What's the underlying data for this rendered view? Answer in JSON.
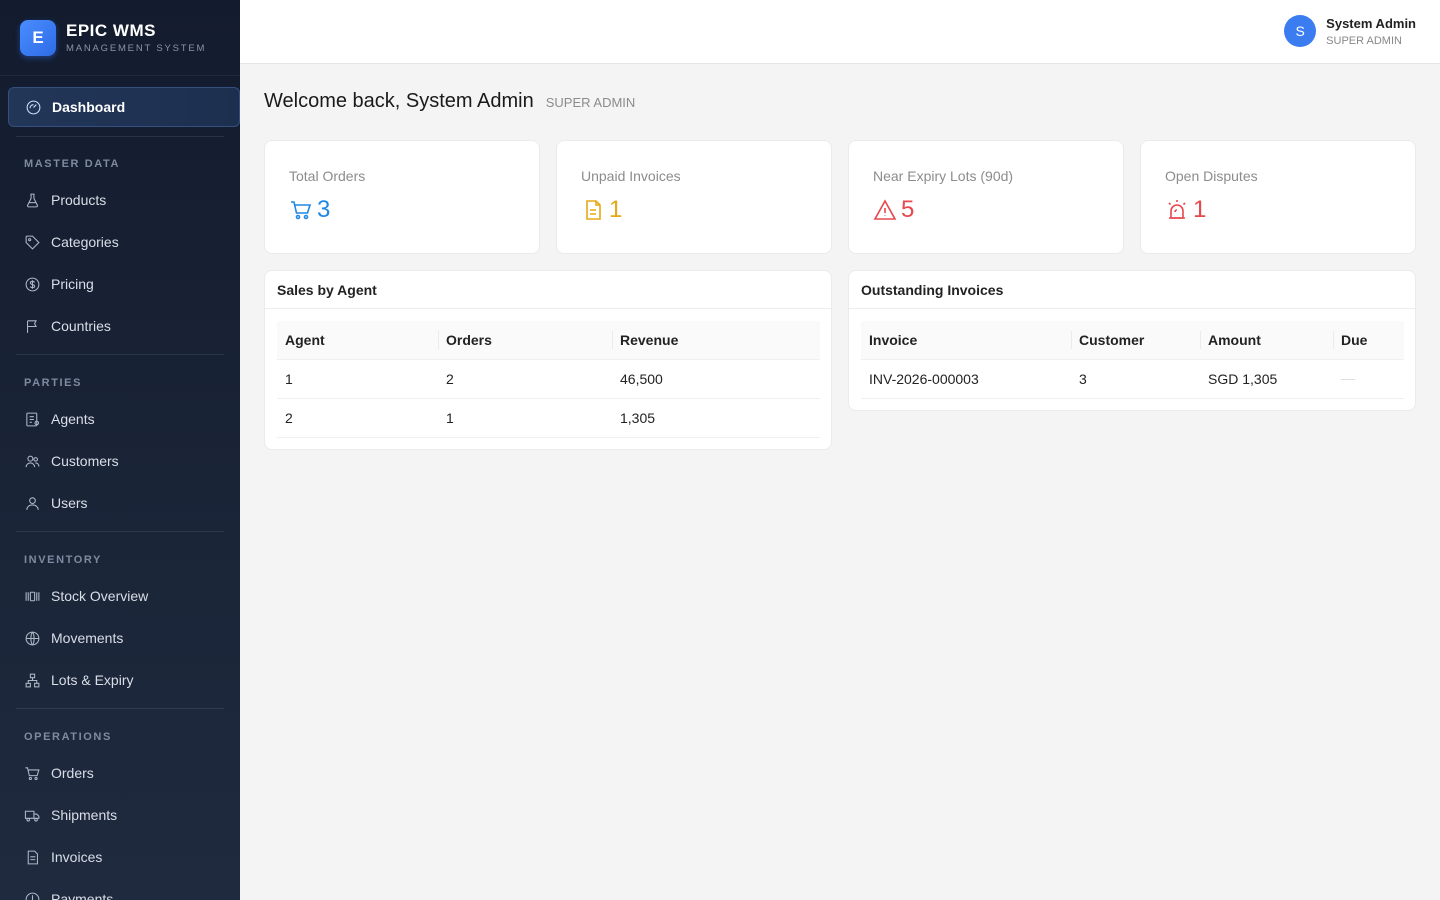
{
  "brand": {
    "logo_letter": "E",
    "title": "EPIC WMS",
    "subtitle": "MANAGEMENT SYSTEM"
  },
  "sidebar": {
    "active": "Dashboard",
    "sections": {
      "master_data": "MASTER DATA",
      "parties": "PARTIES",
      "inventory": "INVENTORY",
      "operations": "OPERATIONS"
    },
    "items": {
      "dashboard": "Dashboard",
      "products": "Products",
      "categories": "Categories",
      "pricing": "Pricing",
      "countries": "Countries",
      "agents": "Agents",
      "customers": "Customers",
      "users": "Users",
      "stock_overview": "Stock Overview",
      "movements": "Movements",
      "lots_expiry": "Lots & Expiry",
      "orders": "Orders",
      "shipments": "Shipments",
      "invoices": "Invoices",
      "payments": "Payments"
    }
  },
  "header": {
    "user_initial": "S",
    "user_name": "System Admin",
    "user_role": "SUPER ADMIN"
  },
  "welcome": {
    "title": "Welcome back, System Admin",
    "role": "SUPER ADMIN"
  },
  "stats": [
    {
      "label": "Total Orders",
      "value": "3",
      "icon": "cart-icon",
      "color": "#1e88e5"
    },
    {
      "label": "Unpaid Invoices",
      "value": "1",
      "icon": "document-icon",
      "color": "#e6a817"
    },
    {
      "label": "Near Expiry Lots (90d)",
      "value": "5",
      "icon": "warning-icon",
      "color": "#e5484d"
    },
    {
      "label": "Open Disputes",
      "value": "1",
      "icon": "alarm-icon",
      "color": "#e5484d"
    }
  ],
  "sales_by_agent": {
    "title": "Sales by Agent",
    "columns": [
      "Agent",
      "Orders",
      "Revenue"
    ],
    "rows": [
      [
        "1",
        "2",
        "46,500"
      ],
      [
        "2",
        "1",
        "1,305"
      ]
    ]
  },
  "outstanding_invoices": {
    "title": "Outstanding Invoices",
    "columns": [
      "Invoice",
      "Customer",
      "Amount",
      "Due"
    ],
    "rows": [
      [
        "INV-2026-000003",
        "3",
        "SGD 1,305",
        ""
      ]
    ]
  },
  "colors": {
    "accent": "#3b7df0",
    "sidebar_bg": "#1b2538"
  }
}
